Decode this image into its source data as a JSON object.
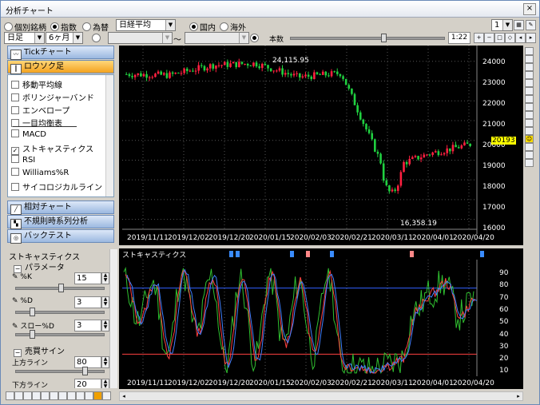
{
  "window": {
    "title": "分析チャート",
    "close": "×"
  },
  "toolbar": {
    "radio_stock": "個別銘柄",
    "radio_index": "指数",
    "radio_fx": "為替",
    "index_select": "日経平均",
    "radio_domestic": "国内",
    "radio_overseas": "海外",
    "layout_select": "1",
    "period_type": "日足",
    "period_range": "6ヶ月",
    "range_sep": "～",
    "scale_label": "本数",
    "scale_ratio": "1:22"
  },
  "nav": {
    "tick": "Tickチャート",
    "candle": "ロウソク足",
    "relative": "相対チャート",
    "irregular": "不規則時系列分析",
    "backtest": "バックテスト",
    "items": [
      {
        "label": "移動平均線",
        "checked": false
      },
      {
        "label": "ボリンジャーバンド",
        "checked": false
      },
      {
        "label": "エンベロープ",
        "checked": false
      },
      {
        "label": "一目均衡表",
        "checked": false
      },
      {
        "label": "MACD",
        "checked": false
      },
      {
        "label": "ストキャスティクス",
        "checked": true
      },
      {
        "label": "RSI",
        "checked": false
      },
      {
        "label": "Williams%R",
        "checked": false
      },
      {
        "label": "サイコロジカルライン",
        "checked": false
      }
    ]
  },
  "params": {
    "title": "ストキャスティクス",
    "group_param": "パラメータ",
    "k_label": "%K",
    "k_value": "15",
    "d_label": "%D",
    "d_value": "3",
    "sd_label": "スロー%D",
    "sd_value": "3",
    "group_signal": "売買サイン",
    "upper_label": "上方ライン",
    "upper_value": "80",
    "lower_label": "下方ライン",
    "lower_value": "20"
  },
  "main_chart": {
    "high_label": "24,115.95",
    "low_label": "16,358.19",
    "current_price": "20193",
    "yticks": [
      "24000",
      "23000",
      "22000",
      "21000",
      "20000",
      "19000",
      "18000",
      "17000",
      "16000"
    ],
    "xticks": [
      "2019/11/11",
      "2019/12/02",
      "2019/12/20",
      "2020/01/15",
      "2020/02/03",
      "2020/02/21",
      "2020/03/11",
      "2020/04/01",
      "2020/04/20"
    ]
  },
  "sub_chart": {
    "title": "ストキャスティクス",
    "yticks": [
      "90",
      "80",
      "70",
      "60",
      "50",
      "40",
      "30",
      "20",
      "10"
    ],
    "xticks": [
      "2019/11/11",
      "2019/12/02",
      "2019/12/20",
      "2020/01/15",
      "2020/02/03",
      "2020/02/21",
      "2020/03/11",
      "2020/04/01",
      "2020/04/20"
    ]
  },
  "chart_data": {
    "type": "line",
    "title": "",
    "xlabel": "",
    "ylabel": "",
    "x": [
      "2019/11/11",
      "2019/12/02",
      "2019/12/20",
      "2020/01/15",
      "2020/02/03",
      "2020/02/21",
      "2020/03/11",
      "2020/04/01",
      "2020/04/20"
    ],
    "ylim": [
      15500,
      24800
    ],
    "series": [
      {
        "values": [
          23350,
          23300,
          23800,
          23900,
          23200,
          23400,
          18500,
          19300,
          19800
        ]
      }
    ],
    "annotations": [
      {
        "x": "2020/01/15",
        "y": 24115.95,
        "text": "24,115.95"
      },
      {
        "x": "2020/03/19",
        "y": 16358.19,
        "text": "16,358.19"
      }
    ],
    "stochastic": {
      "ylim": [
        0,
        100
      ],
      "upper_line": 80,
      "lower_line": 20
    },
    "grid": true,
    "legend": "none"
  }
}
